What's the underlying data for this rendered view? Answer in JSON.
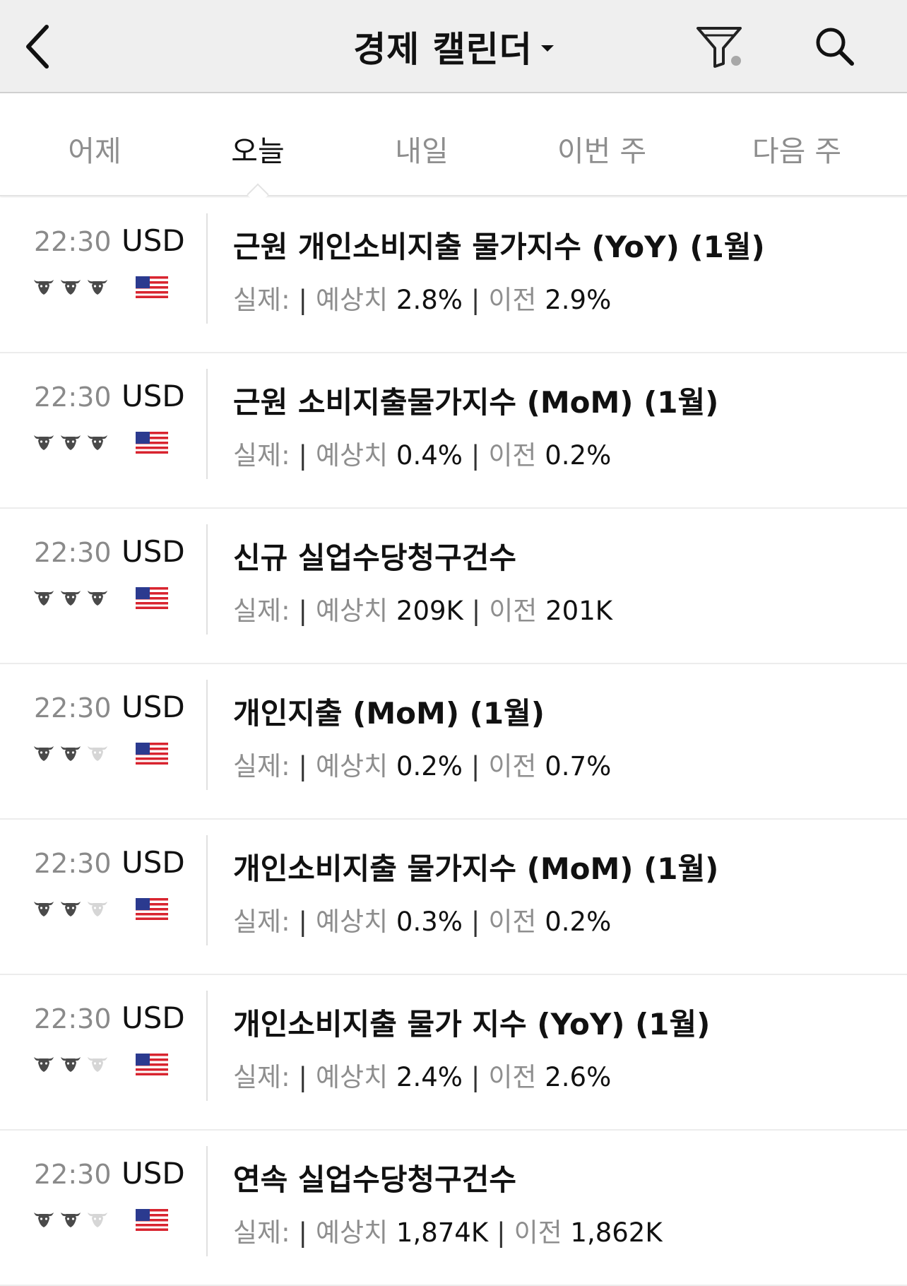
{
  "header": {
    "title": "경제 캘린더",
    "back_icon": "chevron-left-icon",
    "filter_icon": "filter-icon",
    "search_icon": "search-icon"
  },
  "tabs": [
    {
      "label": "어제",
      "active": false
    },
    {
      "label": "오늘",
      "active": true
    },
    {
      "label": "내일",
      "active": false
    },
    {
      "label": "이번 주",
      "active": false
    },
    {
      "label": "다음 주",
      "active": false
    }
  ],
  "labels": {
    "actual": "실제:",
    "forecast": "예상치",
    "previous": "이전",
    "separator": "|"
  },
  "colors": {
    "bull_active": "#4a4a4a",
    "bull_inactive": "#d6d6d6"
  },
  "events": [
    {
      "time": "22:30",
      "currency": "USD",
      "importance": 3,
      "title": "근원 개인소비지출 물가지수 (YoY) (1월)",
      "actual": "",
      "forecast": "2.8%",
      "previous": "2.9%"
    },
    {
      "time": "22:30",
      "currency": "USD",
      "importance": 3,
      "title": "근원 소비지출물가지수 (MoM) (1월)",
      "actual": "",
      "forecast": "0.4%",
      "previous": "0.2%"
    },
    {
      "time": "22:30",
      "currency": "USD",
      "importance": 3,
      "title": "신규 실업수당청구건수",
      "actual": "",
      "forecast": "209K",
      "previous": "201K"
    },
    {
      "time": "22:30",
      "currency": "USD",
      "importance": 2,
      "title": "개인지출 (MoM) (1월)",
      "actual": "",
      "forecast": "0.2%",
      "previous": "0.7%"
    },
    {
      "time": "22:30",
      "currency": "USD",
      "importance": 2,
      "title": "개인소비지출 물가지수 (MoM) (1월)",
      "actual": "",
      "forecast": "0.3%",
      "previous": "0.2%"
    },
    {
      "time": "22:30",
      "currency": "USD",
      "importance": 2,
      "title": "개인소비지출 물가 지수 (YoY) (1월)",
      "actual": "",
      "forecast": "2.4%",
      "previous": "2.6%"
    },
    {
      "time": "22:30",
      "currency": "USD",
      "importance": 2,
      "title": "연속 실업수당청구건수",
      "actual": "",
      "forecast": "1,874K",
      "previous": "1,862K"
    }
  ]
}
